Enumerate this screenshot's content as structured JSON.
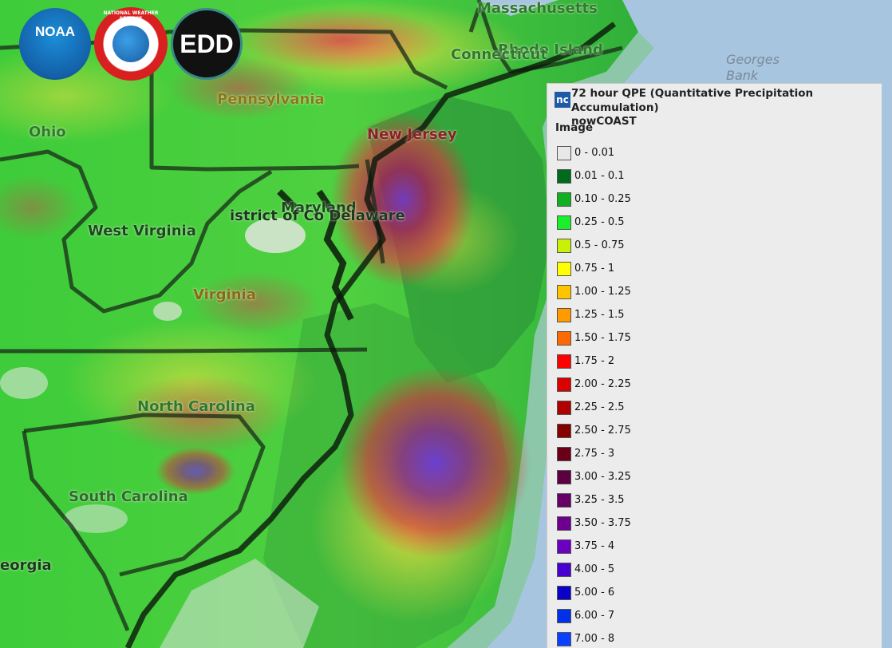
{
  "map": {
    "state_labels": [
      {
        "name": "massachusetts-label",
        "text": "Massachusetts"
      },
      {
        "name": "rhode-island-label",
        "text": "Rhode Island"
      },
      {
        "name": "connecticut-label",
        "text": "Connecticut"
      },
      {
        "name": "pennsylvania-label",
        "text": "Pennsylvania"
      },
      {
        "name": "ohio-label",
        "text": "Ohio"
      },
      {
        "name": "new-jersey-label",
        "text": "New Jersey"
      },
      {
        "name": "maryland-label",
        "text": "Maryland"
      },
      {
        "name": "district-of-columbia-delaware-label",
        "text": "istrict of Co Delaware"
      },
      {
        "name": "west-virginia-label",
        "text": "West Virginia"
      },
      {
        "name": "virginia-label",
        "text": "Virginia"
      },
      {
        "name": "north-carolina-label",
        "text": "North Carolina"
      },
      {
        "name": "south-carolina-label",
        "text": "South Carolina"
      },
      {
        "name": "georgia-label",
        "text": "eorgia"
      }
    ],
    "ocean_label": "Georges Bank",
    "logos": [
      {
        "name": "noaa-logo",
        "text": "NOAA"
      },
      {
        "name": "national-weather-service-logo",
        "text": "NATIONAL WEATHER SERVICE"
      },
      {
        "name": "edd-logo",
        "text": "EDD"
      }
    ]
  },
  "legend": {
    "badge": "nc",
    "title": "72 hour QPE (Quantitative Precipitation Accumulation)",
    "subtitle": "nowCOAST",
    "group": "Image",
    "items": [
      {
        "label": "0 - 0.01",
        "color": "#e8e8e8"
      },
      {
        "label": "0.01 - 0.1",
        "color": "#006b1a"
      },
      {
        "label": "0.10 - 0.25",
        "color": "#10b020"
      },
      {
        "label": "0.25 - 0.5",
        "color": "#18f02a"
      },
      {
        "label": "0.5 - 0.75",
        "color": "#c8f008"
      },
      {
        "label": "0.75 - 1",
        "color": "#ffff00"
      },
      {
        "label": "1.00 - 1.25",
        "color": "#ffc400"
      },
      {
        "label": "1.25 - 1.5",
        "color": "#ff9a00"
      },
      {
        "label": "1.50 - 1.75",
        "color": "#ff6a00"
      },
      {
        "label": "1.75 - 2",
        "color": "#ff0000"
      },
      {
        "label": "2.00 - 2.25",
        "color": "#d80000"
      },
      {
        "label": "2.25 - 2.5",
        "color": "#b00000"
      },
      {
        "label": "2.50 - 2.75",
        "color": "#860000"
      },
      {
        "label": "2.75 - 3",
        "color": "#6a0018"
      },
      {
        "label": "3.00 - 3.25",
        "color": "#5c0040"
      },
      {
        "label": "3.25 - 3.5",
        "color": "#660066"
      },
      {
        "label": "3.50 - 3.75",
        "color": "#6e0090"
      },
      {
        "label": "3.75 - 4",
        "color": "#6a00c0"
      },
      {
        "label": "4.00 - 5",
        "color": "#4800d0"
      },
      {
        "label": "5.00 - 6",
        "color": "#0a00c8"
      },
      {
        "label": "6.00 - 7",
        "color": "#0030e8"
      },
      {
        "label": "7.00 - 8",
        "color": "#0a40ff"
      }
    ]
  }
}
